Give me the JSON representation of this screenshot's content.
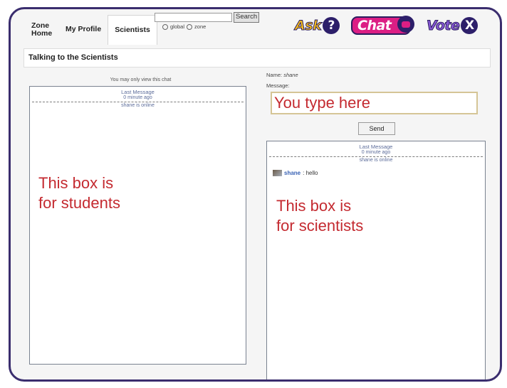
{
  "nav": {
    "tabs": [
      {
        "label": "Zone Home"
      },
      {
        "label": "My Profile"
      },
      {
        "label": "Scientists"
      }
    ]
  },
  "search": {
    "button_label": "Search",
    "scope_global": "global",
    "scope_zone": "zone"
  },
  "actions": {
    "ask": {
      "label": "Ask",
      "symbol": "?"
    },
    "chat": {
      "label": "Chat"
    },
    "vote": {
      "label": "Vote",
      "symbol": "X"
    }
  },
  "page": {
    "title": "Talking to the Scientists"
  },
  "students_box": {
    "note": "You may only view this chat",
    "last_message_label": "Last Message",
    "last_message_time": "0 minute ago",
    "online_text": "shane is online",
    "annotation_line1": "This box is",
    "annotation_line2": "for students"
  },
  "form": {
    "name_label": "Name:",
    "name_value": "shane",
    "message_label": "Message:",
    "message_value": "You type here",
    "send_label": "Send"
  },
  "scientists_box": {
    "last_message_label": "Last Message",
    "last_message_time": "0 minute ago",
    "online_text": "shane is online",
    "messages": [
      {
        "user": "shane",
        "text": ": hello"
      }
    ],
    "annotation_line1": "This box is",
    "annotation_line2": "for scientists"
  },
  "colors": {
    "frame_border": "#3a2d6e",
    "chat_pink": "#dc1e84",
    "ask_yellow": "#f6be1f",
    "vote_purple": "#8a5ad8",
    "annotation_red": "#c42a30",
    "link_blue": "#5c6c9a"
  }
}
